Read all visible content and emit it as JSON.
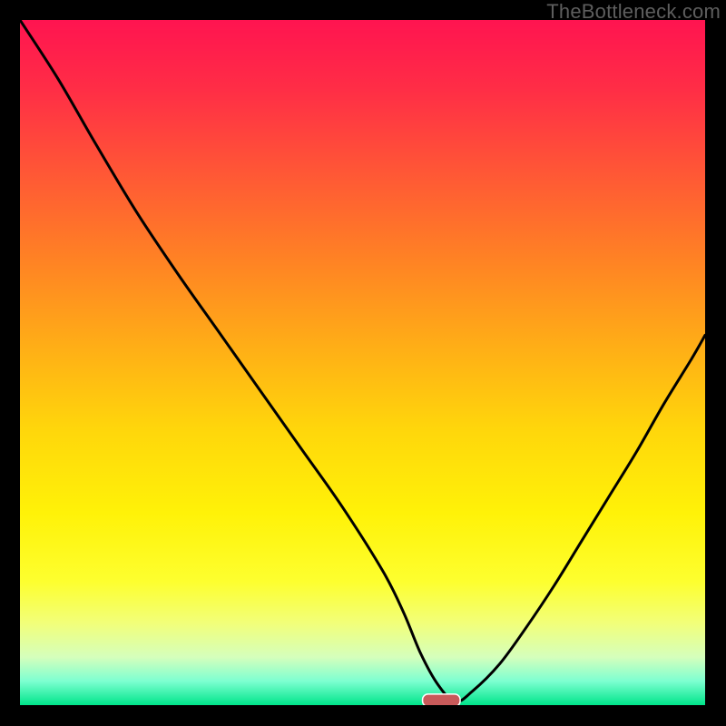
{
  "watermark": "TheBottleneck.com",
  "colors": {
    "gradient_stops": [
      {
        "offset": 0.0,
        "color": "#ff1450"
      },
      {
        "offset": 0.1,
        "color": "#ff2d46"
      },
      {
        "offset": 0.22,
        "color": "#ff5636"
      },
      {
        "offset": 0.35,
        "color": "#ff8224"
      },
      {
        "offset": 0.48,
        "color": "#ffaf16"
      },
      {
        "offset": 0.6,
        "color": "#ffd70b"
      },
      {
        "offset": 0.72,
        "color": "#fff208"
      },
      {
        "offset": 0.82,
        "color": "#fdff2f"
      },
      {
        "offset": 0.88,
        "color": "#f2ff79"
      },
      {
        "offset": 0.93,
        "color": "#d5ffbc"
      },
      {
        "offset": 0.965,
        "color": "#7dffd1"
      },
      {
        "offset": 1.0,
        "color": "#00e58a"
      }
    ],
    "curve": "#000000",
    "marker_fill": "#c85a5a",
    "marker_stroke": "#ffffff"
  },
  "chart_data": {
    "type": "line",
    "x": [
      0.0,
      0.055,
      0.11,
      0.17,
      0.23,
      0.29,
      0.35,
      0.41,
      0.47,
      0.53,
      0.56,
      0.585,
      0.61,
      0.635,
      0.66,
      0.7,
      0.74,
      0.78,
      0.82,
      0.86,
      0.9,
      0.94,
      0.98,
      1.0
    ],
    "y": [
      1.0,
      0.915,
      0.82,
      0.72,
      0.63,
      0.545,
      0.46,
      0.375,
      0.29,
      0.195,
      0.135,
      0.075,
      0.03,
      0.005,
      0.02,
      0.06,
      0.115,
      0.175,
      0.24,
      0.305,
      0.37,
      0.44,
      0.505,
      0.54
    ],
    "marker": {
      "x_center": 0.615,
      "y": 0.007,
      "width": 0.055,
      "height": 0.018
    },
    "title": "",
    "xlabel": "",
    "ylabel": "",
    "xlim": [
      0,
      1
    ],
    "ylim": [
      0,
      1
    ]
  }
}
